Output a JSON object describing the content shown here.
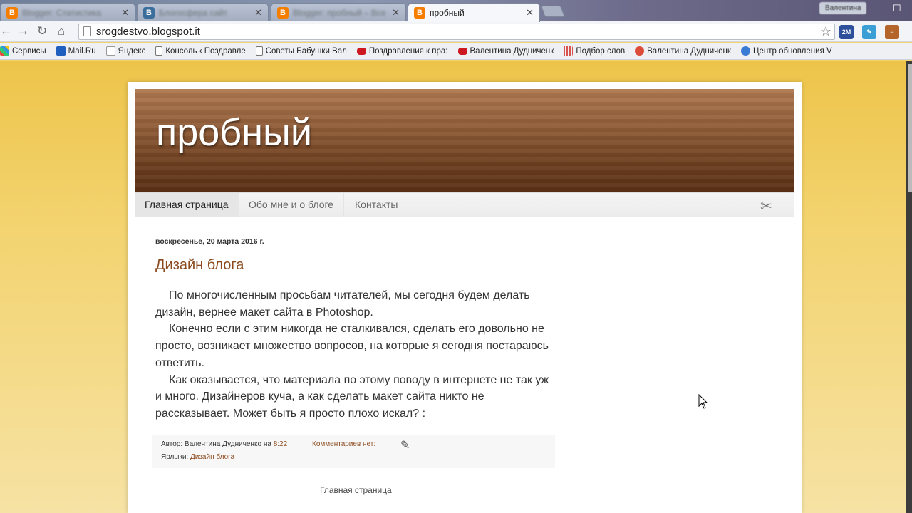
{
  "browser": {
    "tabs": [
      {
        "title": "Blogger: Статистика",
        "favicon": "B",
        "blurred": true
      },
      {
        "title": "Блогосфера сайт",
        "favicon": "B",
        "blurred": true
      },
      {
        "title": "Blogger: пробный – Все с",
        "favicon": "B",
        "blurred": true
      },
      {
        "title": "пробный",
        "favicon": "B",
        "blurred": false
      }
    ],
    "user_badge": "Валентина",
    "url": "srogdestvo.blogspot.it",
    "bookmarks": [
      {
        "label": "Сервисы",
        "icon": "apps-icon",
        "color": "#e74c3c"
      },
      {
        "label": "Mail.Ru",
        "icon": "mailru-icon",
        "color": "#1f5fbf"
      },
      {
        "label": "Яндекс",
        "icon": "yandex-icon",
        "color": "#e31e24"
      },
      {
        "label": "Консоль ‹ Поздравле",
        "icon": "page-icon",
        "color": "#888888"
      },
      {
        "label": "Советы Бабушки Вал",
        "icon": "page-icon",
        "color": "#888888"
      },
      {
        "label": "Поздравления к пра:",
        "icon": "youtube-icon",
        "color": "#cc181e"
      },
      {
        "label": "Валентина Дудниченк",
        "icon": "youtube-icon",
        "color": "#cc181e"
      },
      {
        "label": "Подбор слов",
        "icon": "stats-icon",
        "color": "#d9534f"
      },
      {
        "label": "Валентина Дудниченк",
        "icon": "google-icon",
        "color": "#dd4b39"
      },
      {
        "label": "Центр обновления V",
        "icon": "update-icon",
        "color": "#3a7bd5"
      }
    ]
  },
  "blog": {
    "title": "пробный",
    "nav_tabs": [
      "Главная страница",
      "Обо мне и о блоге",
      "Контакты"
    ],
    "post": {
      "date": "воскресенье, 20 марта 2016 г.",
      "title": "Дизайн блога",
      "paragraphs": [
        "По многочисленным просьбам читателей, мы сегодня будем делать дизайн, вернее макет сайта в Photoshop.",
        "Конечно если с этим никогда не сталкивался, сделать его довольно не просто, возникает множество вопросов, на которые я сегодня постараюсь ответить.",
        "Как оказывается, что материала по этому поводу в интернете не так уж и много. Дизайнеров куча, а как сделать макет сайта никто не рассказывает. Может быть я просто плохо искал? :"
      ],
      "author_prefix": "Автор:",
      "author": "Валентина Дудниченко",
      "time_prefix": "на",
      "time": "8:22",
      "comments": "Комментариев нет:",
      "labels_prefix": "Ярлыки:",
      "label": "Дизайн блога"
    },
    "home_link": "Главная страница"
  },
  "colors": {
    "accent": "#8b4a1e",
    "background": "#f3d36b"
  }
}
